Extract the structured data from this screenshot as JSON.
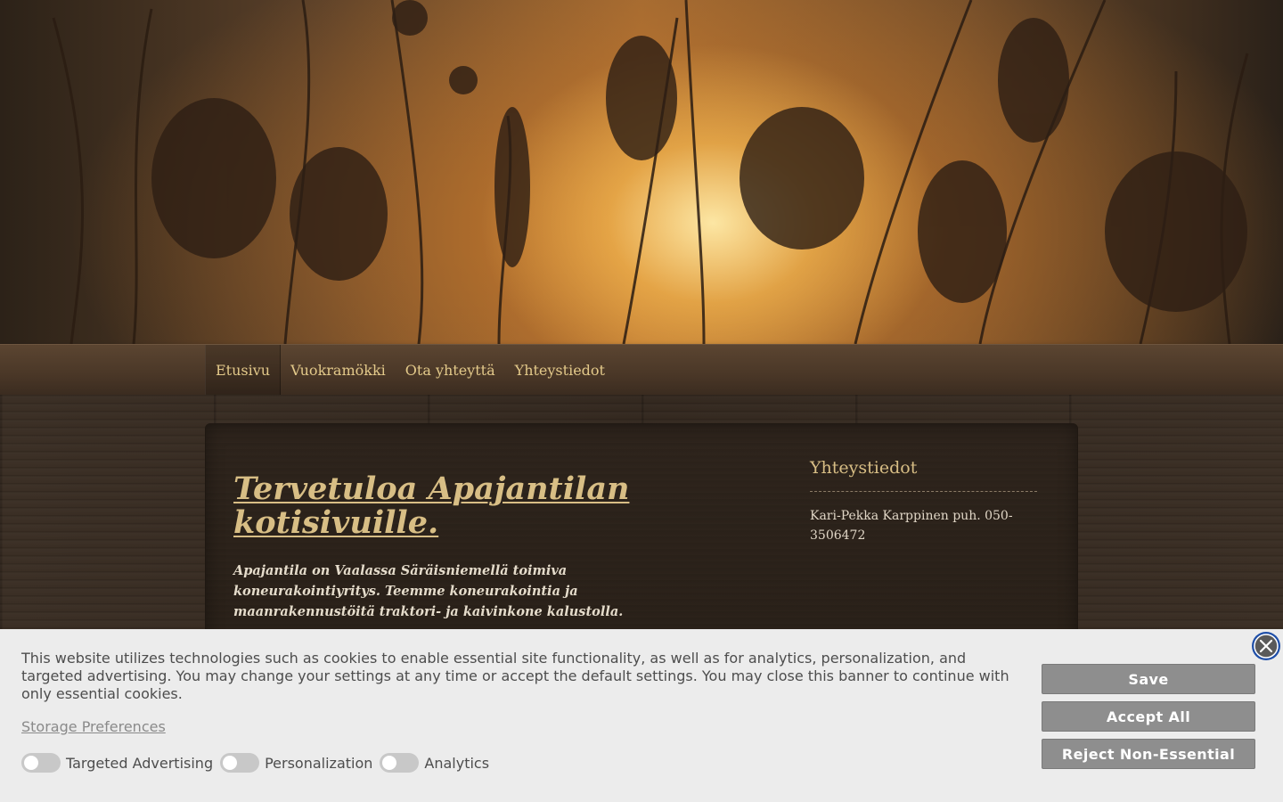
{
  "nav": {
    "items": [
      {
        "label": "Etusivu",
        "active": true
      },
      {
        "label": "Vuokramökki",
        "active": false
      },
      {
        "label": "Ota yhteyttä",
        "active": false
      },
      {
        "label": "Yhteystiedot",
        "active": false
      }
    ]
  },
  "main": {
    "title": "Tervetuloa Apajantilan kotisivuille.",
    "intro": "Apajantila on Vaalassa Säräisniemellä toimiva koneurakointiyritys. Teemme koneurakointia ja maanrakennustöitä traktori- ja kaivinkone kalustolla."
  },
  "sidebar": {
    "heading": "Yhteystiedot",
    "text": "Kari-Pekka Karppinen puh. 050-3506472"
  },
  "cookie_banner": {
    "text": "This website utilizes technologies such as cookies to enable essential site functionality, as well as for analytics, personalization, and targeted advertising. You may change your settings at any time or accept the default settings. You may close this banner to continue with only essential cookies.",
    "preferences_link": "Storage Preferences",
    "toggles": [
      {
        "label": "Targeted Advertising",
        "on": false
      },
      {
        "label": "Personalization",
        "on": false
      },
      {
        "label": "Analytics",
        "on": false
      }
    ],
    "buttons": {
      "save": "Save",
      "accept_all": "Accept All",
      "reject": "Reject Non-Essential"
    },
    "close_icon": "close-icon"
  },
  "colors": {
    "nav_text": "#e3c98a",
    "title": "#d8be85",
    "banner_bg": "#ececec",
    "button_bg": "#8e8e8e",
    "close_ring": "#1f4fa8"
  }
}
